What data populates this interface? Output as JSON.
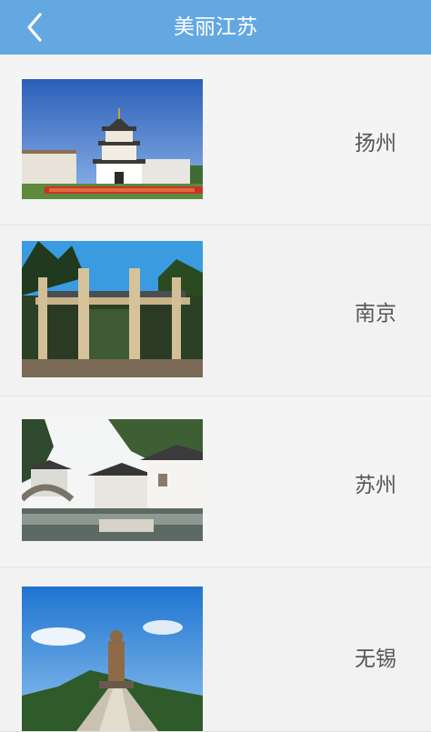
{
  "header": {
    "title": "美丽江苏",
    "back_icon": "chevron-left-icon",
    "background": "#64a8e2"
  },
  "cities": [
    {
      "name": "扬州",
      "image": "yangzhou-pagoda-photo"
    },
    {
      "name": "南京",
      "image": "nanjing-memorial-archway-photo"
    },
    {
      "name": "苏州",
      "image": "suzhou-canal-town-photo"
    },
    {
      "name": "无锡",
      "image": "wuxi-lingshan-buddha-photo"
    }
  ]
}
